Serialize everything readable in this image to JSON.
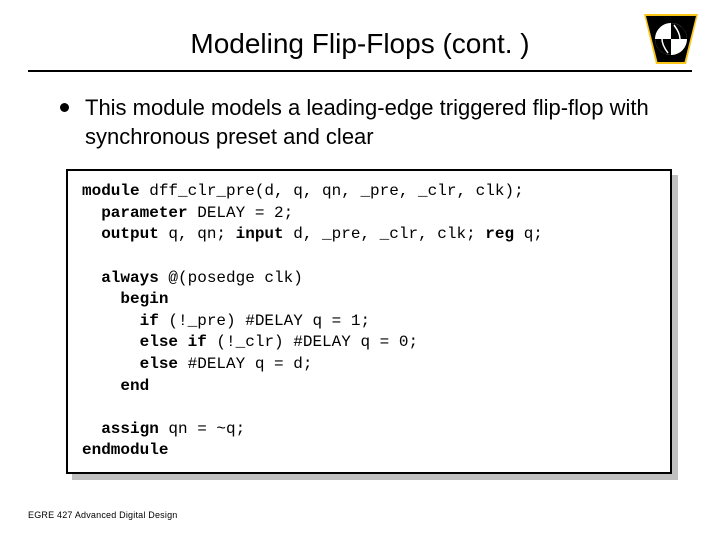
{
  "title": "Modeling Flip-Flops (cont. )",
  "bullet": "This module models a leading-edge triggered flip-flop with synchronous preset and clear",
  "code": {
    "l1a": "module",
    "l1b": " dff_clr_pre(d, q, qn, _pre, _clr, clk);",
    "l2a": "  parameter",
    "l2b": " DELAY = 2;",
    "l3a": "  output",
    "l3b": " q, qn; ",
    "l3c": "input",
    "l3d": " d, _pre, _clr, clk; ",
    "l3e": "reg",
    "l3f": " q;",
    "blank1": "",
    "l4a": "  always",
    "l4b": " @(posedge clk)",
    "l5a": "    begin",
    "l6a": "      if",
    "l6b": " (!_pre) #DELAY q = 1;",
    "l7a": "      else if",
    "l7b": " (!_clr) #DELAY q = 0;",
    "l8a": "      else",
    "l8b": " #DELAY q = d;",
    "l9a": "    end",
    "blank2": "",
    "l10a": "  assign",
    "l10b": " qn = ~q;",
    "l11a": "endmodule"
  },
  "footer": "EGRE 427 Advanced Digital Design"
}
